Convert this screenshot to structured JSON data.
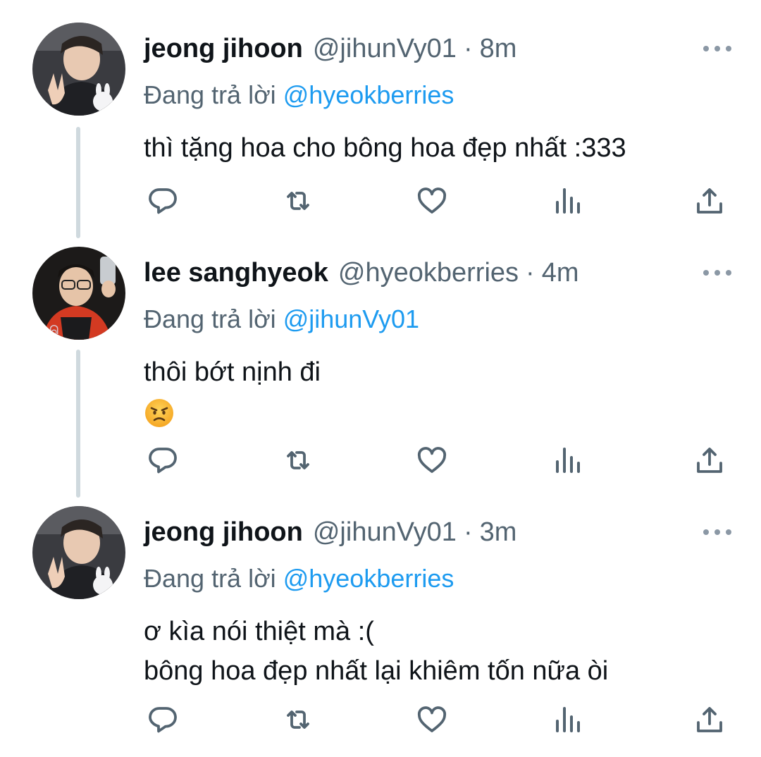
{
  "tweets": [
    {
      "name": "jeong jihoon",
      "handle": "@jihunVy01",
      "separator": "·",
      "time": "8m",
      "replying_prefix": "Đang trả lời",
      "replying_to": "@hyeokberries",
      "lines": [
        "thì tặng hoa cho bông hoa đẹp nhất :333"
      ]
    },
    {
      "name": "lee sanghyeok",
      "handle": "@hyeokberries",
      "separator": "·",
      "time": "4m",
      "replying_prefix": "Đang trả lời",
      "replying_to": "@jihunVy01",
      "lines": [
        "thôi bớt nịnh đi"
      ],
      "emoji": "angry-face"
    },
    {
      "name": "jeong jihoon",
      "handle": "@jihunVy01",
      "separator": "·",
      "time": "3m",
      "replying_prefix": "Đang trả lời",
      "replying_to": "@hyeokberries",
      "lines": [
        "ơ kìa nói thiệt mà :(",
        "bông hoa đẹp nhất lại khiêm tốn nữa òi"
      ]
    }
  ],
  "icons": {
    "more": "more-dots-icon",
    "reply": "reply-bubble-icon",
    "retweet": "retweet-icon",
    "like": "heart-icon",
    "views": "views-bars-icon",
    "share": "share-upload-icon"
  },
  "colors": {
    "text": "#0f1419",
    "muted": "#536471",
    "mention": "#1d9bf0",
    "thread_line": "#cfd9de"
  }
}
